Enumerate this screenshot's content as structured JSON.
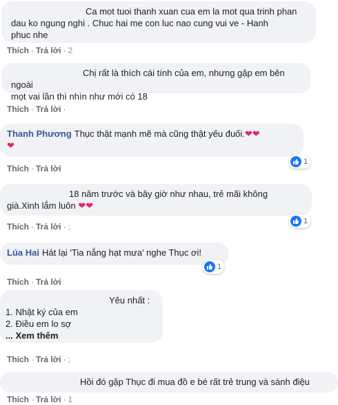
{
  "labels": {
    "like": "Thích",
    "reply": "Trả lời",
    "dot": "·"
  },
  "comments": [
    {
      "author": "",
      "text_lines": [
        "Ca mot tuoi thanh xuan cua em la mot qua trinh phan",
        "dau ko ngung nghi . Chuc hai me con luc nao cung vui ve - Hanh",
        "phuc nhe"
      ],
      "time": "2"
    },
    {
      "author": "",
      "text_lines": [
        "Chị rất là thích cái tính của em, nhưng gặp em bên ngoài",
        "mọt vai lần thì nhìn như mới có 18"
      ],
      "time": ""
    },
    {
      "author": "Thanh Phương",
      "text_lines": [
        "Thục thật mạnh mẽ mà cũng thật yếu đuối.",
        ""
      ],
      "hearts": "❤❤",
      "hearts2": "❤",
      "reactions": "1"
    },
    {
      "author": "",
      "text_lines": [
        "18 năm trước và bây giờ như nhau, trẻ mãi không",
        "già.Xinh lắm luôn "
      ],
      "hearts": "❤❤",
      "time": ";",
      "reactions": "1"
    },
    {
      "author": "Lúa Hai",
      "text_lines": [
        "Hát lại 'Tia nắng hạt mưa' nghe Thục ơi!"
      ],
      "reactions": "1"
    },
    {
      "author": "",
      "text_lines": [
        "Yêu nhất :",
        "1. Nhật ký của em",
        "2. Điều em lo sợ",
        "... Xem thêm"
      ],
      "time": ";"
    },
    {
      "author": "",
      "text_lines": [
        "Hồi đó gặp Thục đi mua đồ e bé rất trẻ trung và sành điệu"
      ],
      "time": "1"
    }
  ]
}
